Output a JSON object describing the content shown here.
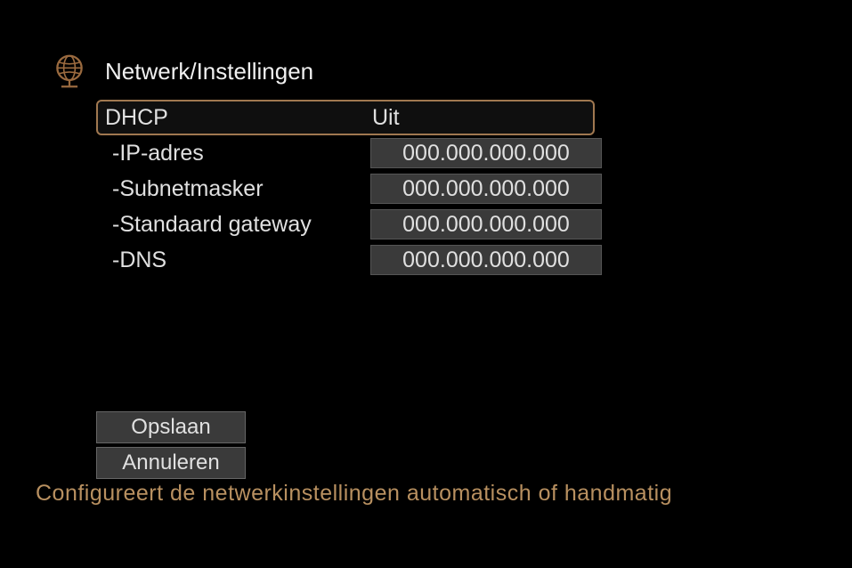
{
  "colors": {
    "accent_border": "#a07850",
    "help_text": "#b89060"
  },
  "title": "Netwerk/Instellingen",
  "settings": {
    "dhcp": {
      "label": "DHCP",
      "value": "Uit",
      "selected": true
    },
    "ip_address": {
      "label": "-IP-adres",
      "value": "000.000.000.000"
    },
    "subnet_mask": {
      "label": "-Subnetmasker",
      "value": "000.000.000.000"
    },
    "default_gateway": {
      "label": "-Standaard gateway",
      "value": "000.000.000.000"
    },
    "dns": {
      "label": "-DNS",
      "value": "000.000.000.000"
    }
  },
  "buttons": {
    "save": "Opslaan",
    "cancel": "Annuleren"
  },
  "help": "Configureert de netwerkinstellingen automatisch of handmatig"
}
